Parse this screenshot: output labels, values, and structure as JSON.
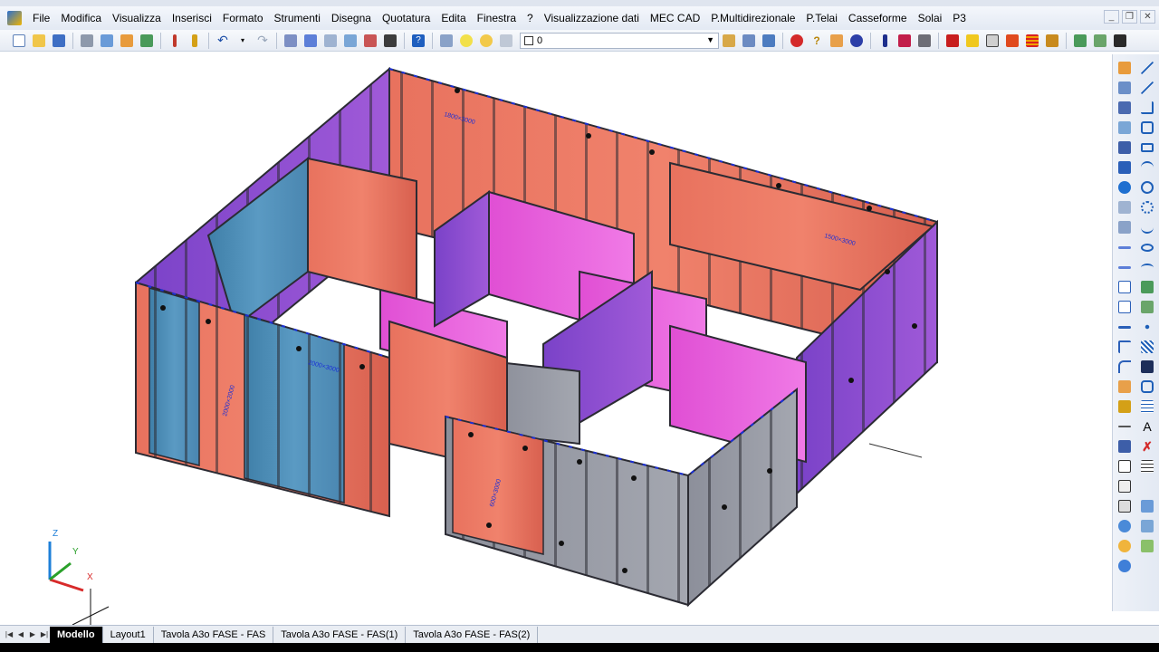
{
  "menu": {
    "items": [
      "File",
      "Modifica",
      "Visualizza",
      "Inserisci",
      "Formato",
      "Strumenti",
      "Disegna",
      "Quotatura",
      "Edita",
      "Finestra",
      "?",
      "Visualizzazione dati",
      "MEC CAD",
      "P.Multidirezionale",
      "P.Telai",
      "Casseforme",
      "Solai",
      "P3"
    ]
  },
  "toolbar": {
    "layer_value": "0"
  },
  "ucs": {
    "z": "Z",
    "y": "Y",
    "x": "X"
  },
  "panels": {
    "label_a": "1800×3000",
    "label_b": "1500×3000",
    "label_c": "2000×3000",
    "label_d": "2000×2000",
    "label_e": "600×3000"
  },
  "tabs": [
    "Modello",
    "Layout1",
    "Tavola A3o FASE - FAS",
    "Tavola A3o FASE - FAS(1)",
    "Tavola A3o FASE - FAS(2)"
  ],
  "colors": {
    "panel_red": "#e8725e",
    "panel_blue": "#4f8fb6",
    "panel_purple": "#8b4fd0",
    "panel_magenta": "#e35bd8",
    "panel_grey": "#8f929c",
    "frame_dark": "#2b2b33",
    "accent_blue": "#1a2fd6"
  }
}
